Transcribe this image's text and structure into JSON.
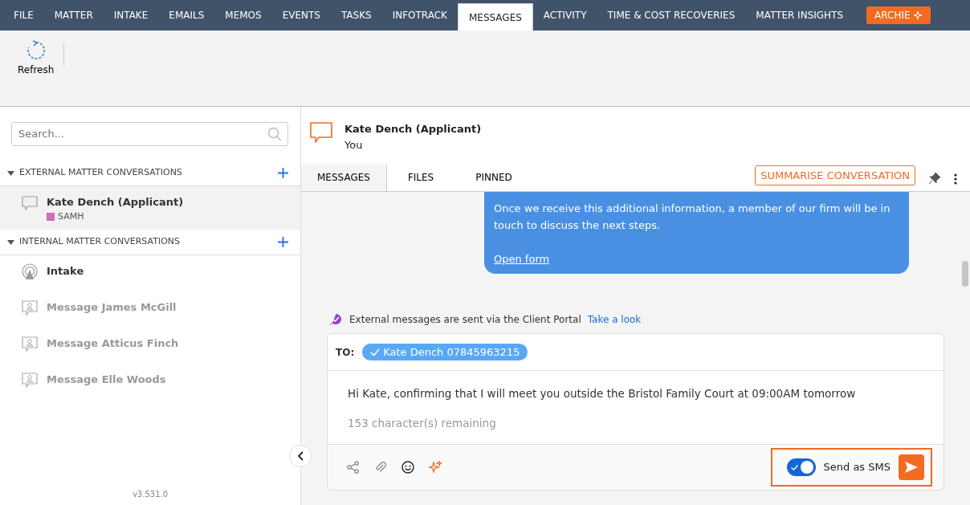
{
  "tabs": [
    {
      "label": "FILE",
      "selected": false
    },
    {
      "label": "MATTER",
      "selected": false
    },
    {
      "label": "INTAKE",
      "selected": false
    },
    {
      "label": "EMAILS",
      "selected": false
    },
    {
      "label": "MEMOS",
      "selected": false
    },
    {
      "label": "EVENTS",
      "selected": false
    },
    {
      "label": "TASKS",
      "selected": false
    },
    {
      "label": "INFOTRACK",
      "selected": false
    },
    {
      "label": "MESSAGES",
      "selected": true
    },
    {
      "label": "ACTIVITY",
      "selected": false
    },
    {
      "label": "TIME & COST RECOVERIES",
      "selected": false
    },
    {
      "label": "MATTER INSIGHTS",
      "selected": false
    }
  ],
  "archie_button": "ARCHIE",
  "toolbar": {
    "refresh_label": "Refresh"
  },
  "sidebar": {
    "search": {
      "placeholder": "Search..."
    },
    "sections": [
      {
        "title": "EXTERNAL MATTER CONVERSATIONS",
        "expanded": true,
        "items": [
          {
            "kind": "chat",
            "name": "Kate Dench (Applicant)",
            "tag": "SAMH",
            "color": "#cc6fbd",
            "selected": true
          }
        ]
      },
      {
        "title": "INTERNAL MATTER CONVERSATIONS",
        "expanded": true,
        "items": [
          {
            "kind": "channel",
            "name": "Intake",
            "selected": false
          },
          {
            "kind": "direct",
            "name": "Message James McGill",
            "selected": false
          },
          {
            "kind": "direct",
            "name": "Message Atticus Finch",
            "selected": false
          },
          {
            "kind": "direct",
            "name": "Message Elle Woods",
            "selected": false
          }
        ]
      }
    ],
    "version": "v3.531.0"
  },
  "conversation": {
    "title": "Kate Dench (Applicant)",
    "subtitle": "You",
    "tabs": [
      {
        "label": "MESSAGES",
        "selected": true
      },
      {
        "label": "FILES",
        "selected": false
      },
      {
        "label": "PINNED",
        "selected": false
      }
    ],
    "summarise_button": "SUMMARISE CONVERSATION",
    "message": {
      "text": "Once we receive this additional information, a member of our firm will be in touch to discuss the next steps.",
      "link": "Open form"
    },
    "notice": {
      "text": "External messages are sent via the Client Portal",
      "link": "Take a look"
    },
    "composer": {
      "to_label": "TO:",
      "recipient": "Kate Dench 07845963215",
      "value": "Hi Kate, confirming that I will meet you outside the Bristol Family Court at 09:00AM tomorrow",
      "remaining": "153 character(s) remaining",
      "send_as_sms": {
        "label": "Send as SMS",
        "on": true
      }
    }
  }
}
